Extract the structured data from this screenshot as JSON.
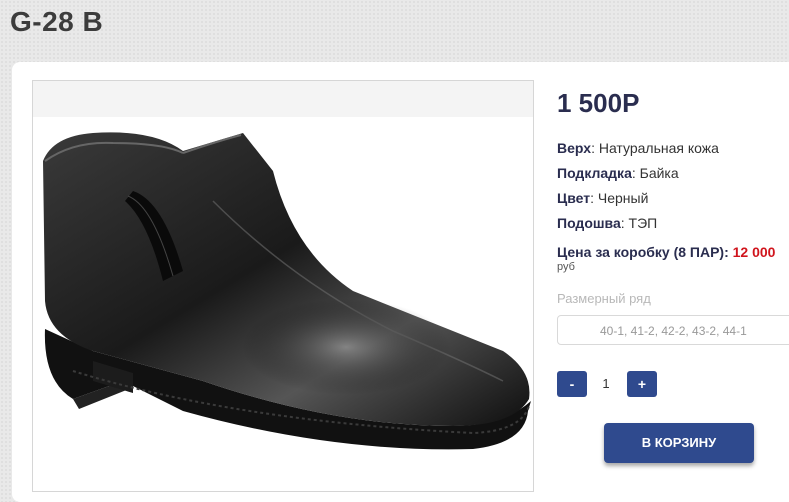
{
  "page": {
    "title": "G-28 B"
  },
  "product": {
    "image_alt": "black leather ankle boot",
    "price": "1 500Р",
    "specs": [
      {
        "key": "Верх",
        "sep": ": ",
        "value": "Натуральная кожа"
      },
      {
        "key": "Подкладка",
        "sep": ": ",
        "value": "Байка"
      },
      {
        "key": "Цвет",
        "sep": ": ",
        "value": "Черный"
      },
      {
        "key": "Подошва",
        "sep": ": ",
        "value": "ТЭП"
      }
    ],
    "box_price_label": "Цена за коробку (8 ПАР): ",
    "box_price_value": "12 000",
    "box_price_currency": "руб"
  },
  "sizes": {
    "label": "Размерный ряд",
    "value": "40-1, 41-2, 42-2, 43-2, 44-1"
  },
  "quantity": {
    "minus": "-",
    "value": "1",
    "plus": "+"
  },
  "cart_button": "В КОРЗИНУ",
  "colors": {
    "accent": "#2f4a8e",
    "price_red": "#d0141c",
    "heading": "#2a2d4f"
  }
}
